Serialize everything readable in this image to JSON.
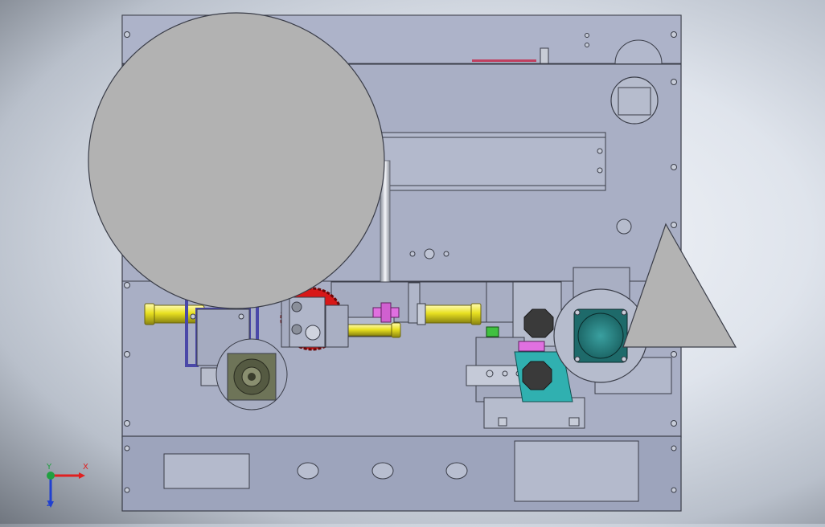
{
  "viewport": {
    "background_center": "#f4f6fa",
    "background_edge": "#70767f",
    "model_face_color": "#aab0c6",
    "model_edge_color": "#3a3d48"
  },
  "triad": {
    "x_label": "X",
    "y_label": "Y",
    "z_label": "Z",
    "x_color": "#e02020",
    "y_color": "#20a040",
    "z_color": "#2040d0"
  },
  "parts": {
    "gear_color": "#d81818",
    "rod_color": "#e8e020",
    "fitting_color": "#e070e0",
    "bracket_color": "#4a48a8",
    "motor_color": "#207a7a",
    "plate_color": "#30b0b0",
    "indicator_color": "#40c040"
  }
}
